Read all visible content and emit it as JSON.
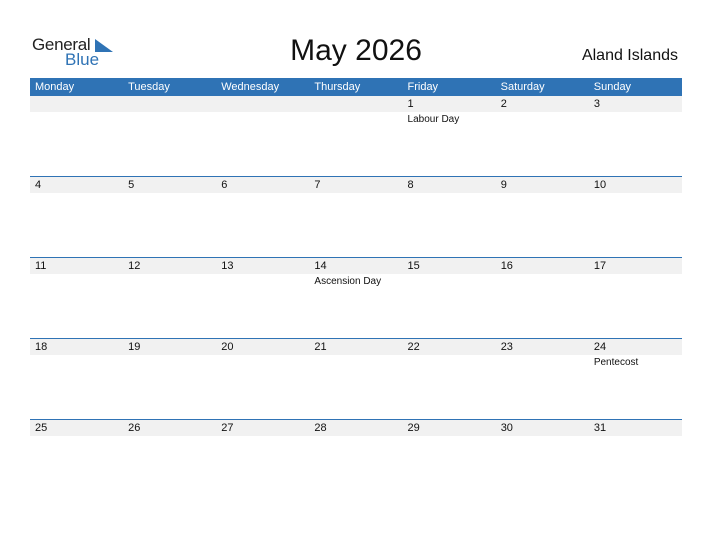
{
  "logo": {
    "line1": "General",
    "line2": "Blue",
    "icon": "triangle-flag-icon",
    "accent_color": "#2f73b5"
  },
  "title": "May 2026",
  "country": "Aland Islands",
  "weekdays": [
    "Monday",
    "Tuesday",
    "Wednesday",
    "Thursday",
    "Friday",
    "Saturday",
    "Sunday"
  ],
  "weeks": [
    [
      {
        "day": ""
      },
      {
        "day": ""
      },
      {
        "day": ""
      },
      {
        "day": ""
      },
      {
        "day": "1",
        "holiday": "Labour Day"
      },
      {
        "day": "2"
      },
      {
        "day": "3"
      }
    ],
    [
      {
        "day": "4"
      },
      {
        "day": "5"
      },
      {
        "day": "6"
      },
      {
        "day": "7"
      },
      {
        "day": "8"
      },
      {
        "day": "9"
      },
      {
        "day": "10"
      }
    ],
    [
      {
        "day": "11"
      },
      {
        "day": "12"
      },
      {
        "day": "13"
      },
      {
        "day": "14",
        "holiday": "Ascension Day"
      },
      {
        "day": "15"
      },
      {
        "day": "16"
      },
      {
        "day": "17"
      }
    ],
    [
      {
        "day": "18"
      },
      {
        "day": "19"
      },
      {
        "day": "20"
      },
      {
        "day": "21"
      },
      {
        "day": "22"
      },
      {
        "day": "23"
      },
      {
        "day": "24",
        "holiday": "Pentecost"
      }
    ],
    [
      {
        "day": "25"
      },
      {
        "day": "26"
      },
      {
        "day": "27"
      },
      {
        "day": "28"
      },
      {
        "day": "29"
      },
      {
        "day": "30"
      },
      {
        "day": "31"
      }
    ]
  ]
}
